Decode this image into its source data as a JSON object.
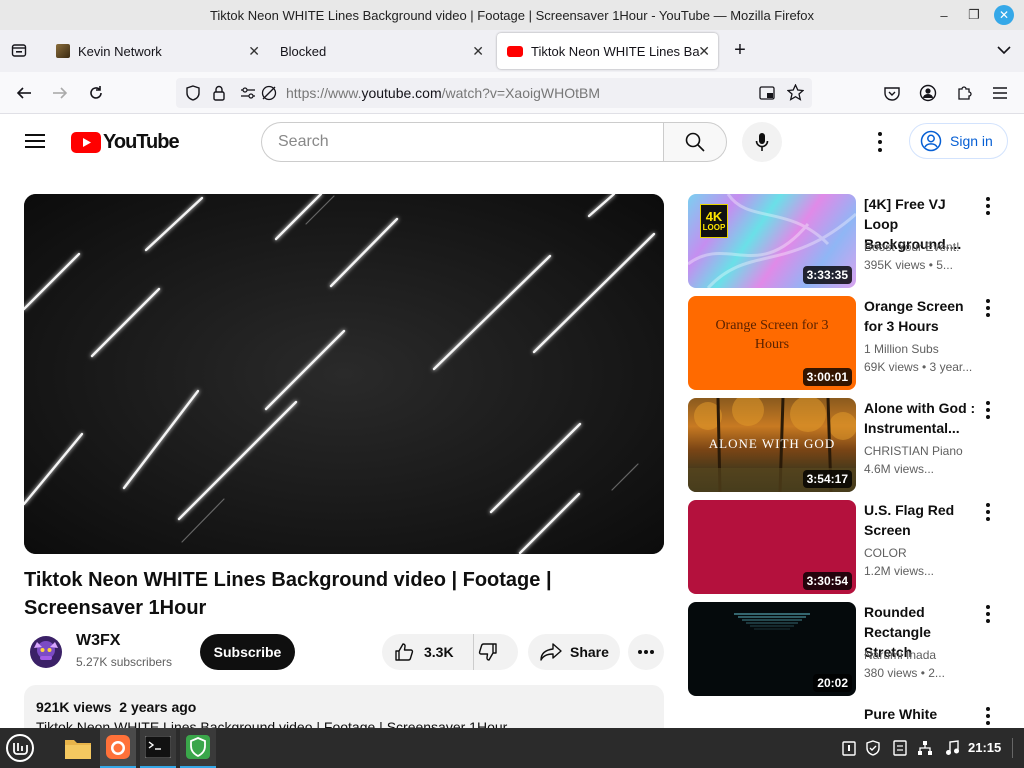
{
  "window": {
    "title": "Tiktok Neon WHITE Lines Background video | Footage | Screensaver 1Hour - YouTube — Mozilla Firefox"
  },
  "tabs": [
    {
      "label": "Kevin Network",
      "active": false
    },
    {
      "label": "Blocked",
      "active": false
    },
    {
      "label": "Tiktok Neon WHITE Lines Ba",
      "active": true
    }
  ],
  "navbar": {
    "url_prefix": "https://www.",
    "url_host": "youtube.com",
    "url_path": "/watch?v=XaoigWHOtBM"
  },
  "youtube": {
    "logo_text": "YouTube",
    "search_placeholder": "Search",
    "signin_label": "Sign in",
    "accent": "#ff0000"
  },
  "video": {
    "title": "Tiktok Neon WHITE Lines Background video | Footage | Screensaver 1Hour",
    "channel_name": "W3FX",
    "subscribers": "5.27K subscribers",
    "subscribe_label": "Subscribe",
    "likes": "3.3K",
    "share_label": "Share",
    "views": "921K views",
    "age": "2 years ago",
    "description_first_line": "Tiktok Neon WHITE Lines Background video | Footage | Screensaver 1Hour"
  },
  "recommendations": [
    {
      "title": "[4K] Free VJ Loop Background....",
      "channel": "Boost Your Event!",
      "meta": "395K views  • 5...",
      "duration": "3:33:35",
      "thumb_badge_top": "4K",
      "thumb_badge_bottom": "LOOP"
    },
    {
      "title": "Orange Screen for 3 Hours",
      "channel": "1 Million Subs",
      "meta": "69K views  • 3 year...",
      "duration": "3:00:01",
      "thumb_text": "Orange Screen for 3 Hours"
    },
    {
      "title": "Alone with God : Instrumental...",
      "channel": "CHRISTIAN Piano",
      "meta": "4.6M views...",
      "duration": "3:54:17",
      "thumb_text": "ALONE WITH GOD"
    },
    {
      "title": "U.S. Flag Red Screen",
      "channel": "COLOR",
      "meta": "1.2M views...",
      "duration": "3:30:54"
    },
    {
      "title": "Rounded Rectangle Stretch",
      "channel": "Narumi Inada",
      "meta": "380 views  • 2...",
      "duration": "20:02"
    },
    {
      "title": "Pure White",
      "channel": "",
      "meta": "",
      "duration": ""
    }
  ],
  "taskbar": {
    "clock": "21:15"
  }
}
